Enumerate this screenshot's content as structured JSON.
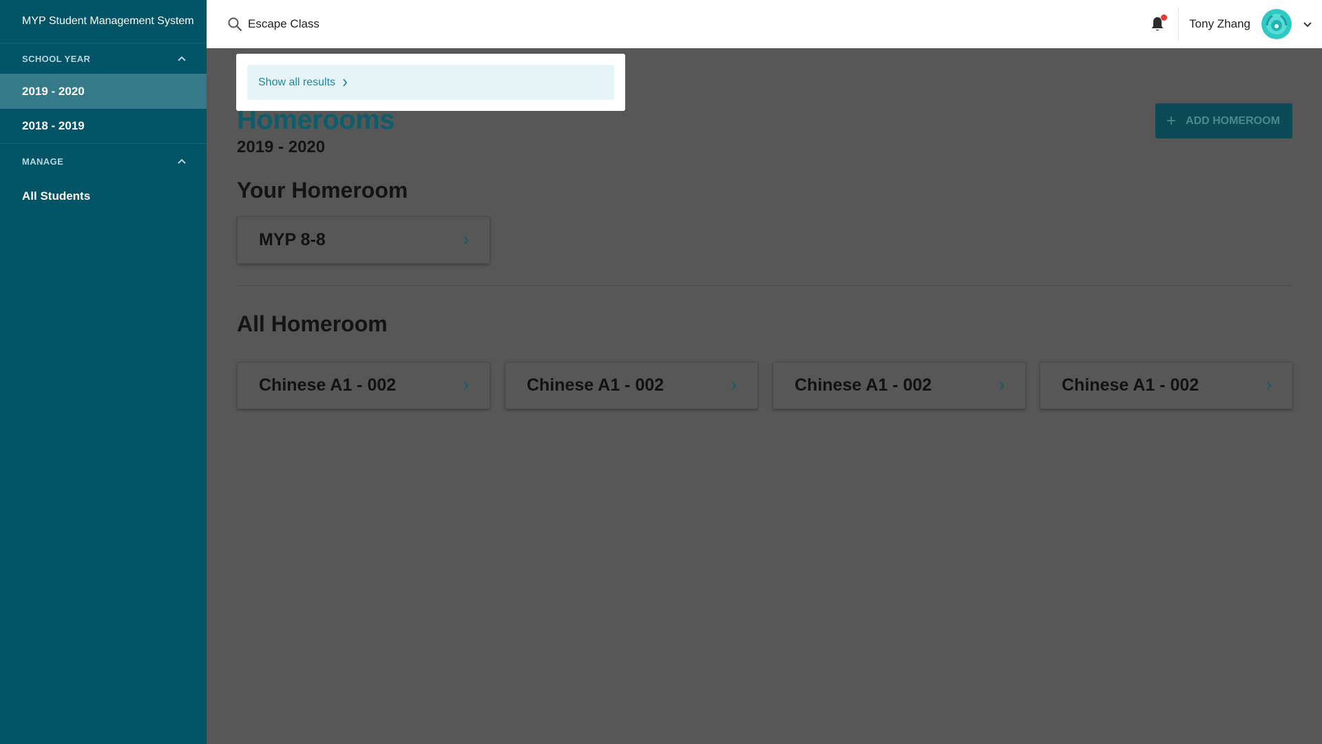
{
  "sidebar": {
    "app_title": "MYP Student Management System",
    "sections": [
      {
        "header": "SCHOOL YEAR",
        "items": [
          "2019 - 2020",
          "2018 - 2019"
        ]
      },
      {
        "header": "MANAGE",
        "items": [
          "All Students"
        ]
      }
    ],
    "active_item": "2019 - 2020"
  },
  "topbar": {
    "search_value": "Escape Class",
    "user_name": "Tony Zhang",
    "notification_dot": true
  },
  "search_dropdown": {
    "show_all_label": "Show all results"
  },
  "main": {
    "title": "Homerooms",
    "subtitle": "2019 - 2020",
    "add_button_label": "ADD HOMEROOM",
    "your_homeroom_title": "Your Homeroom",
    "your_homeroom_cards": [
      "MYP 8-8"
    ],
    "all_homeroom_title": "All Homeroom",
    "all_homeroom_cards": [
      "Chinese A1 - 002",
      "Chinese A1 - 002",
      "Chinese A1 - 002",
      "Chinese A1 - 002"
    ]
  },
  "colors": {
    "sidebar_bg": "#005466",
    "sidebar_active": "#357a88",
    "overlay_bg": "#575757",
    "accent": "#1e8aa0",
    "notification": "#e53935"
  }
}
